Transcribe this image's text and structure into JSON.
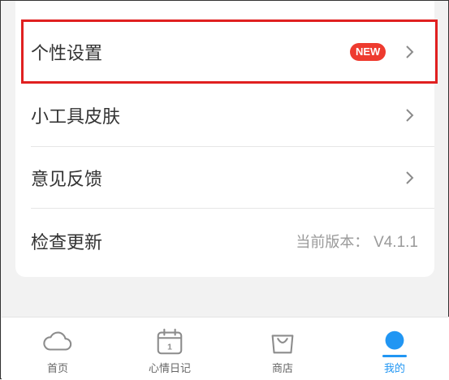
{
  "settings": {
    "items": [
      {
        "label": "个性设置",
        "badge": "NEW"
      },
      {
        "label": "小工具皮肤"
      },
      {
        "label": "意见反馈"
      },
      {
        "label": "检查更新",
        "value": "当前版本：",
        "version": "V4.1.1"
      }
    ]
  },
  "tabbar": {
    "tabs": [
      {
        "label": "首页",
        "icon": "cloud-icon"
      },
      {
        "label": "心情日记",
        "icon": "calendar-icon",
        "calendar_day": "1"
      },
      {
        "label": "商店",
        "icon": "shopping-bag-icon"
      },
      {
        "label": "我的",
        "icon": "profile-icon"
      }
    ],
    "active_index": 3
  },
  "colors": {
    "accent": "#2196f3",
    "badge": "#ee3b2f",
    "highlight_border": "#e02020"
  }
}
